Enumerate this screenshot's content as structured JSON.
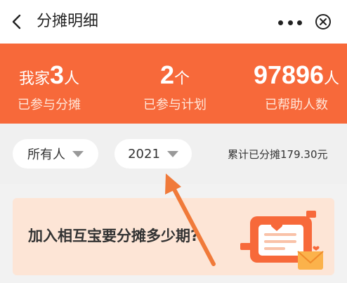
{
  "nav": {
    "title": "分摊明细",
    "icons": [
      "chevron-left-icon",
      "more-icon",
      "close-circle-icon"
    ]
  },
  "stats": [
    {
      "prefix": "我家",
      "value": "3",
      "unit": "人",
      "label": "已参与分摊"
    },
    {
      "prefix": "",
      "value": "2",
      "unit": "个",
      "label": "已参与计划"
    },
    {
      "prefix": "",
      "value": "97896",
      "unit": "人",
      "label": "已帮助人数"
    }
  ],
  "filters": {
    "member": "所有人",
    "year": "2021",
    "total": "累计已分摊179.30元"
  },
  "banner": {
    "text": "加入相互宝要分摊多少期?"
  },
  "colors": {
    "accent": "#f7693a",
    "arrow": "#f07a3a"
  }
}
